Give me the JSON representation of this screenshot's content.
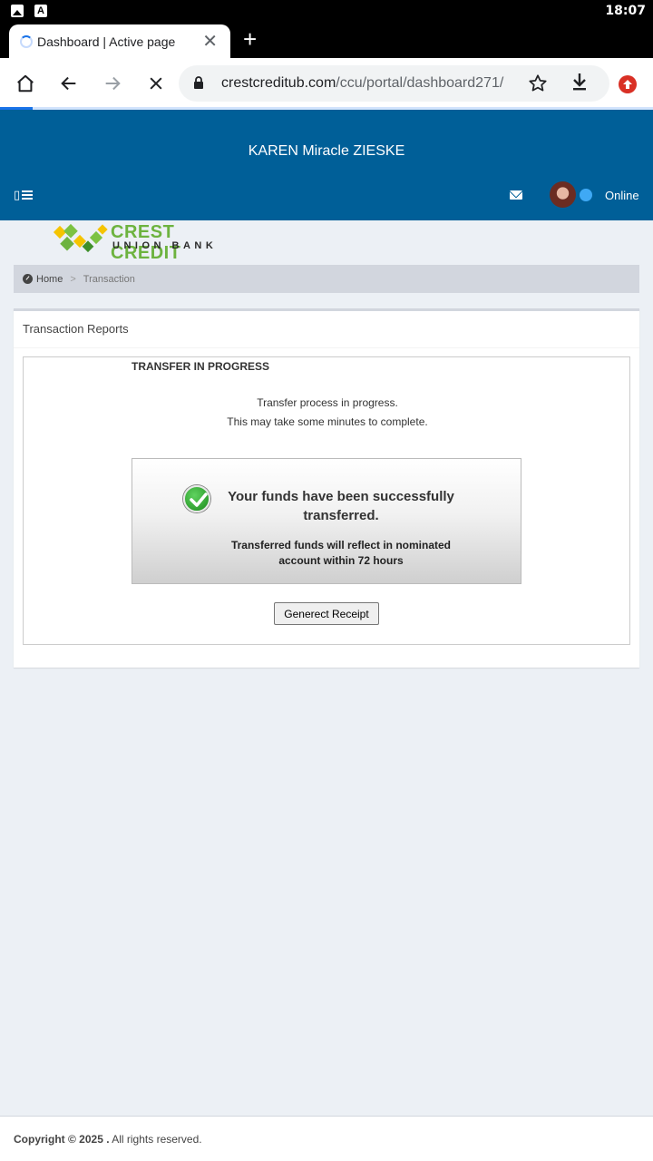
{
  "statusbar": {
    "time": "18:07"
  },
  "browser": {
    "tab_title": "Dashboard | Active page",
    "url_host": "crestcreditub.com",
    "url_path": "/ccu/portal/dashboard271/"
  },
  "header": {
    "user_name": "KAREN Miracle ZIESKE",
    "menu_glyph": "▯",
    "status_label": "Online"
  },
  "logo": {
    "line1": "CREST CREDIT",
    "line2": "UNION BANK"
  },
  "breadcrumb": {
    "home": "Home",
    "separator": ">",
    "current": "Transaction"
  },
  "panel": {
    "title": "Transaction Reports",
    "status_heading": "TRANSFER IN PROGRESS",
    "message_line1": "Transfer process in progress.",
    "message_line2": "This may take some minutes to complete.",
    "success_title": "Your funds have been successfully transferred.",
    "success_note": "Transferred funds will reflect in nominated account within 72 hours",
    "receipt_button": "Generect Receipt"
  },
  "footer": {
    "copyright": "Copyright © 2025 .",
    "rights": " All rights reserved."
  },
  "colors": {
    "header_bg": "#005f98",
    "page_bg": "#ecf0f5",
    "online_dot": "#3fa9f5",
    "logo_green": "#6db33f"
  }
}
